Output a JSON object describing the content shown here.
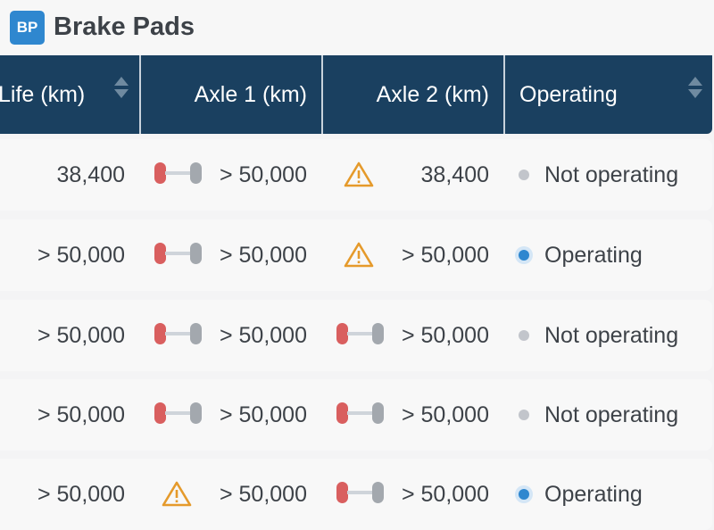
{
  "header": {
    "badge": "BP",
    "title": "Brake Pads"
  },
  "columns": [
    {
      "label": "Life (km)",
      "sortable": true
    },
    {
      "label": "Axle 1 (km)",
      "sortable": false
    },
    {
      "label": "Axle 2 (km)",
      "sortable": false
    },
    {
      "label": "Operating",
      "sortable": true
    }
  ],
  "colors": {
    "header_bg": "#1a4060",
    "accent": "#2f87cf",
    "pad_worn": "#d95f5f",
    "warning": "#e59a2b"
  },
  "rows": [
    {
      "life": "38,400",
      "axle1_icon": "brake-pad-icon",
      "axle1": "> 50,000",
      "axle2_icon": "warning-icon",
      "axle2": "38,400",
      "status": "Not operating",
      "operating": false
    },
    {
      "life": "> 50,000",
      "axle1_icon": "brake-pad-icon",
      "axle1": "> 50,000",
      "axle2_icon": "warning-icon",
      "axle2": "> 50,000",
      "status": "Operating",
      "operating": true
    },
    {
      "life": "> 50,000",
      "axle1_icon": "brake-pad-icon",
      "axle1": "> 50,000",
      "axle2_icon": "brake-pad-icon",
      "axle2": "> 50,000",
      "status": "Not operating",
      "operating": false
    },
    {
      "life": "> 50,000",
      "axle1_icon": "brake-pad-icon",
      "axle1": "> 50,000",
      "axle2_icon": "brake-pad-icon",
      "axle2": "> 50,000",
      "status": "Not operating",
      "operating": false
    },
    {
      "life": "> 50,000",
      "axle1_icon": "warning-icon",
      "axle1": "> 50,000",
      "axle2_icon": "brake-pad-icon",
      "axle2": "> 50,000",
      "status": "Operating",
      "operating": true
    }
  ]
}
